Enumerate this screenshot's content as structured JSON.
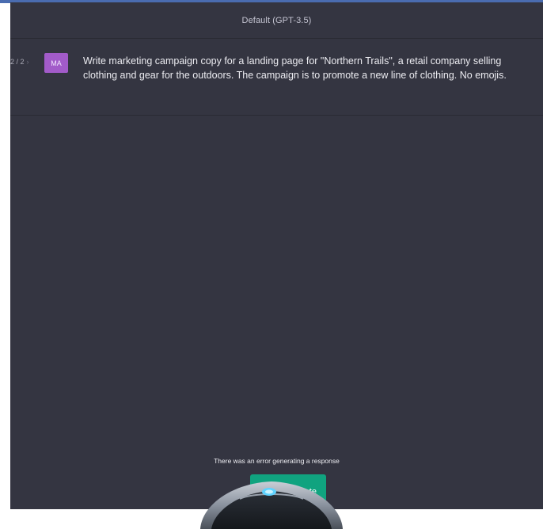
{
  "header": {
    "model": "Default (GPT-3.5)"
  },
  "message": {
    "pager": "2 / 2",
    "avatar_initials": "MA",
    "text": "Write marketing campaign copy for a landing page for \"Northern Trails\", a retail company selling clothing and gear for the outdoors. The campaign is to promote a new line of clothing. No emojis."
  },
  "error": {
    "text": "There was an error generating a response"
  },
  "regenerate": {
    "label": "rate"
  },
  "colors": {
    "background": "#343541",
    "avatar": "#a25bc9",
    "button": "#10a37f",
    "accent_top": "#4a6cb0"
  },
  "icons": {
    "pager_next": "chevron-right-icon",
    "overlay": "robot-mascot-icon"
  }
}
